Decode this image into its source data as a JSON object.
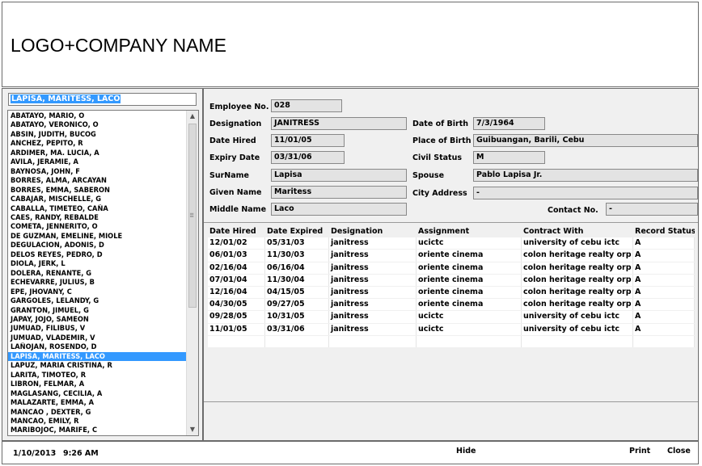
{
  "header": {
    "logo_text": "LOGO+COMPANY NAME"
  },
  "search": {
    "value": "LAPISA, MARITESS, LACO"
  },
  "employee_list": [
    "ABATAYO, MARIO, O",
    "ABATAYO, VERONICO, O",
    "ABSIN, JUDITH, BUCOG",
    "ANCHEZ, PEPITO, R",
    "ARDIMER, MA. LUCIA, A",
    "AVILA, JERAMIE, A",
    "BAYNOSA, JOHN, F",
    "BORRES, ALMA, ARCAYAN",
    "BORRES, EMMA, SABERON",
    "CABAJAR, MISCHELLE, G",
    "CABALLA, TIMETEO, CAÑA",
    "CAES, RANDY, REBALDE",
    "COMETA, JENNERITO, O",
    "DE GUZMAN, EMELINE, MIOLE",
    "DEGULACION, ADONIS, D",
    "DELOS REYES, PEDRO, D",
    "DIOLA, JERK, L",
    "DOLERA, RENANTE, G",
    "ECHEVARRE, JULIUS, B",
    "EPE, JHOVANY, C",
    "GARGOLES, LELANDY, G",
    "GRANTON, JIMUEL, G",
    "JAPAY, JOJO, SAMEON",
    "JUMUAD, FILIBUS, V",
    "JUMUAD, VLADEMIR, V",
    "LAÑOJAN, ROSENDO, D",
    "LAPISA, MARITESS, LACO",
    "LAPUZ, MARIA CRISTINA, R",
    "LARITA, TIMOTEO, R",
    "LIBRON, FELMAR, A",
    "MAGLASANG, CECILIA, A",
    "MALAZARTE, EMMA, A",
    "MANCAO , DEXTER, G",
    "MANCAO, EMILY, R",
    "MARIBOJOC, MARIFE, C"
  ],
  "selected_employee": "LAPISA, MARITESS, LACO",
  "details": {
    "employee_no_label": "Employee No.",
    "employee_no": "028",
    "designation_label": "Designation",
    "designation": "JANITRESS",
    "date_hired_label": "Date Hired",
    "date_hired": "11/01/05",
    "expiry_date_label": "Expiry Date",
    "expiry_date": "03/31/06",
    "surname_label": "SurName",
    "surname": "Lapisa",
    "given_name_label": "Given Name",
    "given_name": "Maritess",
    "middle_name_label": "Middle Name",
    "middle_name": "Laco",
    "date_of_birth_label": "Date of Birth",
    "date_of_birth": "7/3/1964",
    "place_of_birth_label": "Place of Birth",
    "place_of_birth": "Guibuangan, Barili, Cebu",
    "civil_status_label": "Civil Status",
    "civil_status": "M",
    "spouse_label": "Spouse",
    "spouse": "Pablo Lapisa Jr.",
    "city_address_label": "City Address",
    "city_address": "-",
    "contact_no_label": "Contact No.",
    "contact_no": "-"
  },
  "history": {
    "columns": [
      "Date Hired",
      "Date Expired",
      "Designation",
      "Assignment",
      "Contract With",
      "Record Status"
    ],
    "rows": [
      [
        "12/01/02",
        "05/31/03",
        "janitress",
        "ucictc",
        "university of cebu ictc",
        "A"
      ],
      [
        "06/01/03",
        "11/30/03",
        "janitress",
        "oriente cinema",
        "colon heritage realty orp",
        "A"
      ],
      [
        "02/16/04",
        "06/16/04",
        "janitress",
        "oriente cinema",
        "colon heritage realty orp",
        "A"
      ],
      [
        "07/01/04",
        "11/30/04",
        "janitress",
        "oriente cinema",
        "colon heritage realty orp",
        "A"
      ],
      [
        "12/16/04",
        "04/15/05",
        "janitress",
        "oriente cinema",
        "colon heritage realty orp",
        "A"
      ],
      [
        "04/30/05",
        "09/27/05",
        "janitress",
        "oriente cinema",
        "colon heritage realty orp",
        "A"
      ],
      [
        "09/28/05",
        "10/31/05",
        "janitress",
        "ucictc",
        "university of cebu ictc",
        "A"
      ],
      [
        "11/01/05",
        "03/31/06",
        "janitress",
        "ucictc",
        "university of cebu ictc",
        "A"
      ],
      [
        "",
        "",
        "",
        "",
        "",
        ""
      ]
    ]
  },
  "footer": {
    "date": "1/10/2013",
    "time": "9:26 AM",
    "hide_label": "Hide",
    "print_label": "Print",
    "close_label": "Close"
  }
}
